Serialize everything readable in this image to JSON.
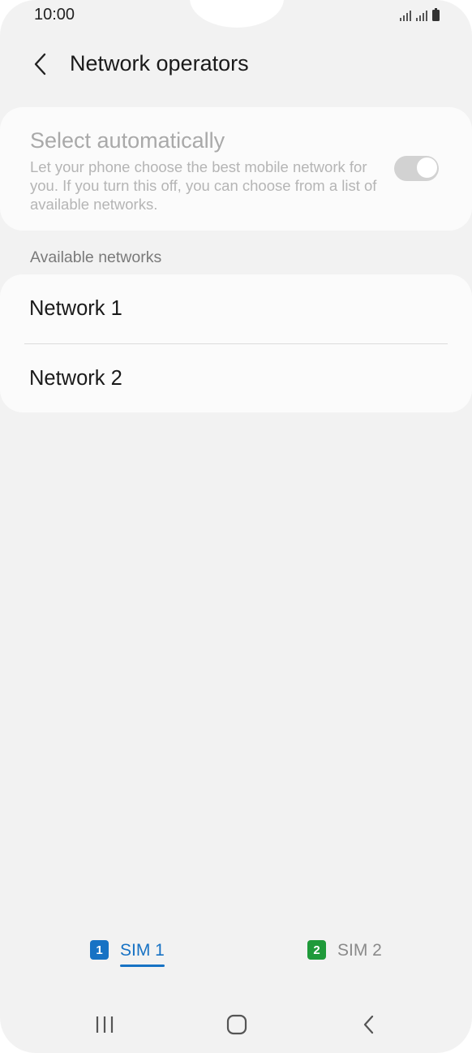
{
  "status_bar": {
    "time": "10:00",
    "icons": [
      "signal-icon",
      "signal-icon",
      "battery-icon"
    ]
  },
  "header": {
    "back_icon": "chevron-left-icon",
    "title": "Network operators"
  },
  "select_automatically": {
    "title": "Select automatically",
    "description": "Let your phone choose the best mobile network for you. If you turn this off, you can choose from a list of available networks.",
    "toggle_on": true,
    "disabled": true
  },
  "available_networks": {
    "header": "Available networks",
    "items": [
      {
        "label": "Network 1"
      },
      {
        "label": "Network 2"
      }
    ]
  },
  "sim_tabs": [
    {
      "badge": "1",
      "label": "SIM 1",
      "selected": true,
      "color": "#1772c4"
    },
    {
      "badge": "2",
      "label": "SIM 2",
      "selected": false,
      "color": "#1f9a3a"
    }
  ],
  "nav_bar": {
    "buttons": [
      "recent-apps-icon",
      "home-icon",
      "back-icon"
    ]
  },
  "colors": {
    "background": "#f2f2f2",
    "card": "#fbfbfb",
    "accent": "#1772c4"
  }
}
